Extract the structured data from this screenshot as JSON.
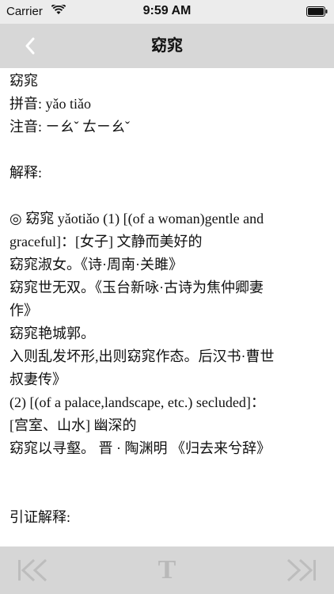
{
  "status_bar": {
    "carrier": "Carrier",
    "time": "9:59 AM"
  },
  "nav": {
    "title": "窈窕",
    "back_icon": "chevron-left-icon"
  },
  "content": {
    "lines": [
      "窈窕",
      "拼音: yǎo tiǎo",
      "注音: ㄧㄠˇ ㄊㄧㄠˇ",
      "",
      "解释:",
      "",
      "◎ 窈窕 yǎotiǎo (1) [(of a woman)gentle and",
      "graceful]：[女子] 文静而美好的",
      "窈窕淑女。《诗·周南·关雎》",
      "窈窕世无双。《玉台新咏·古诗为焦仲卿妻",
      "作》",
      "窈窕艳城郭。",
      "入则乱发坏形,出则窈窕作态。后汉书·曹世",
      "叔妻传》",
      "(2) [(of a palace,landscape, etc.) secluded]：",
      "[宫室、山水] 幽深的",
      "窈窕以寻壑。 晋 · 陶渊明 《归去来兮辞》",
      "",
      "",
      "引证解释:"
    ]
  },
  "toolbar": {
    "prev_icon": "skip-back-icon",
    "font_label": "T",
    "next_icon": "skip-forward-icon"
  },
  "colors": {
    "nav_bg": "#d7d7d7",
    "toolbar_bg": "#d6d6d6",
    "status_bg": "#ececec",
    "icon_muted": "#b9b9b9"
  }
}
